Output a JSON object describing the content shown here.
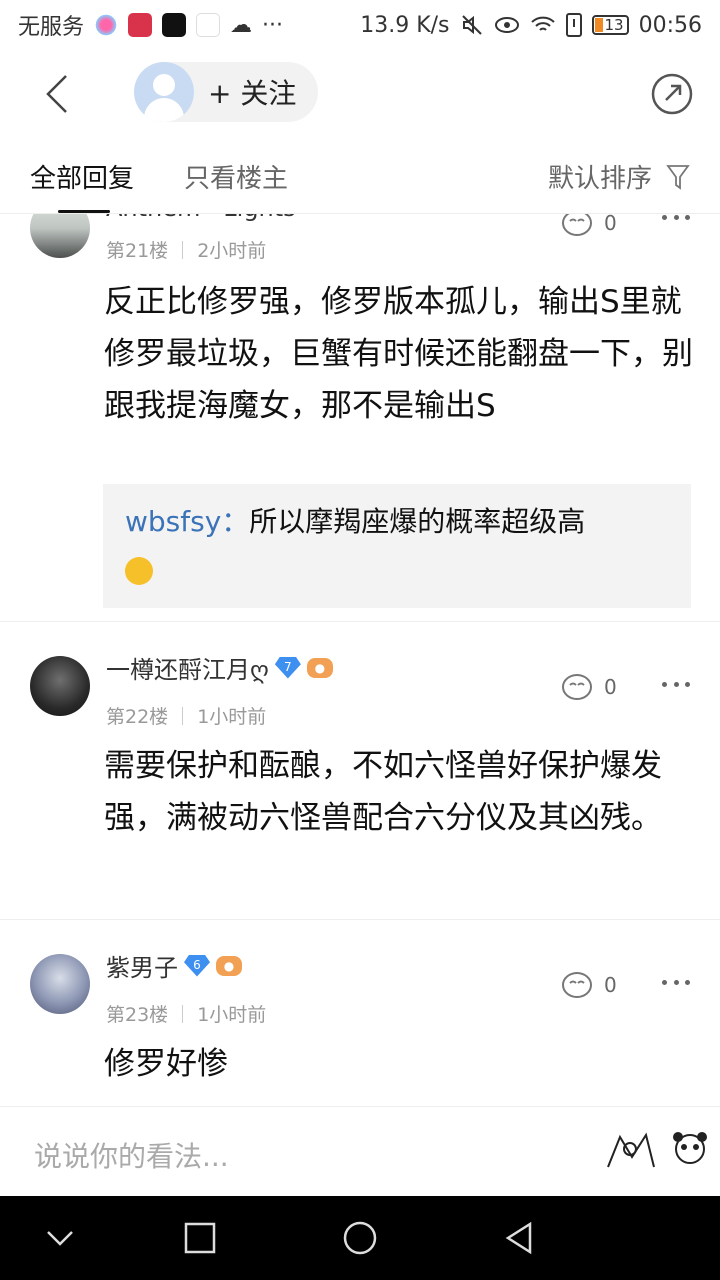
{
  "status": {
    "carrier": "无服务",
    "speed": "13.9 K/s",
    "battery": "13",
    "time": "00:56",
    "more": "···"
  },
  "header": {
    "follow_label": "+ 关注"
  },
  "tabs": {
    "all_replies": "全部回复",
    "op_only": "只看楼主",
    "sort": "默认排序"
  },
  "comments": [
    {
      "user": "Anthem · Lights",
      "floor": "第21楼",
      "time": "2小时前",
      "likes": "0",
      "text": "反正比修罗强，修罗版本孤儿，输出S里就修罗最垃圾，巨蟹有时候还能翻盘一下，别跟我提海魔女，那不是输出S",
      "reply": {
        "user": "wbsfsy：",
        "text": "所以摩羯座爆的概率超级高"
      }
    },
    {
      "user": "一樽还酹江月ღ",
      "level": "7",
      "floor": "第22楼",
      "time": "1小时前",
      "likes": "0",
      "text": "需要保护和酝酿，不如六怪兽好保护爆发强，满被动六怪兽配合六分仪及其凶残。"
    },
    {
      "user": "紫男子",
      "level": "6",
      "floor": "第23楼",
      "time": "1小时前",
      "likes": "0",
      "text": "修罗好惨"
    }
  ],
  "input": {
    "placeholder": "说说你的看法..."
  },
  "colors": {
    "accent_blue": "#3b73b9",
    "level_badge": "#3d8ff0",
    "game_badge": "#f2a154"
  }
}
